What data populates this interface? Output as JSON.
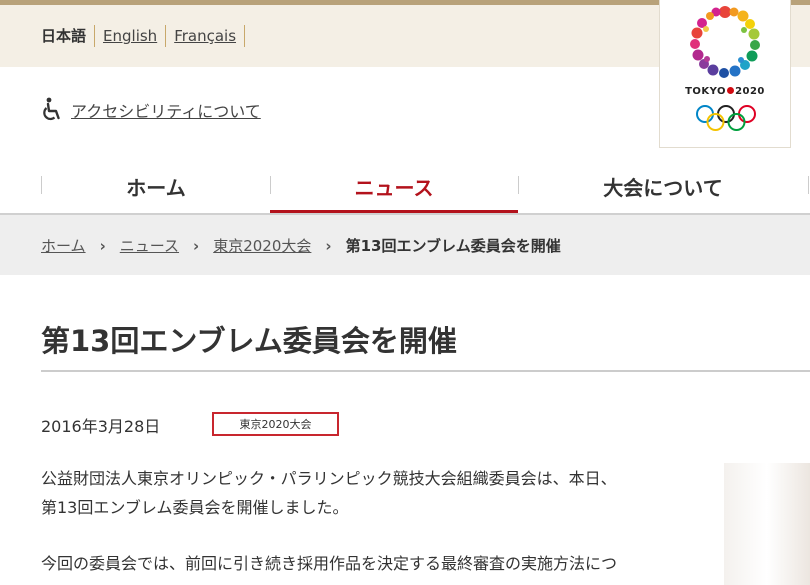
{
  "languages": [
    {
      "label": "日本語"
    },
    {
      "label": "English"
    },
    {
      "label": "Français"
    }
  ],
  "accessibility": {
    "label": "アクセシビリティについて",
    "icon": "wheelchair-icon"
  },
  "logo": {
    "text_left": "TOKYO",
    "text_right": "2020",
    "brand_red": "#d10a11"
  },
  "nav": {
    "items": [
      {
        "label": "ホーム"
      },
      {
        "label": "ニュース",
        "active": true
      },
      {
        "label": "大会について"
      }
    ],
    "accent": "#b3121c"
  },
  "breadcrumb": {
    "items": [
      "ホーム",
      "ニュース",
      "東京2020大会"
    ],
    "separator": "›",
    "current": "第13回エンブレム委員会を開催"
  },
  "article": {
    "title": "第13回エンブレム委員会を開催",
    "date": "2016年3月28日",
    "tag": "東京2020大会",
    "paragraphs": [
      [
        "公益財団法人東京オリンピック・パラリンピック競技大会組織委員会は、本日、",
        "第13回エンブレム委員会を開催しました。"
      ],
      [
        "今回の委員会では、前回に引き続き採用作品を決定する最終審査の実施方法につ"
      ]
    ]
  }
}
